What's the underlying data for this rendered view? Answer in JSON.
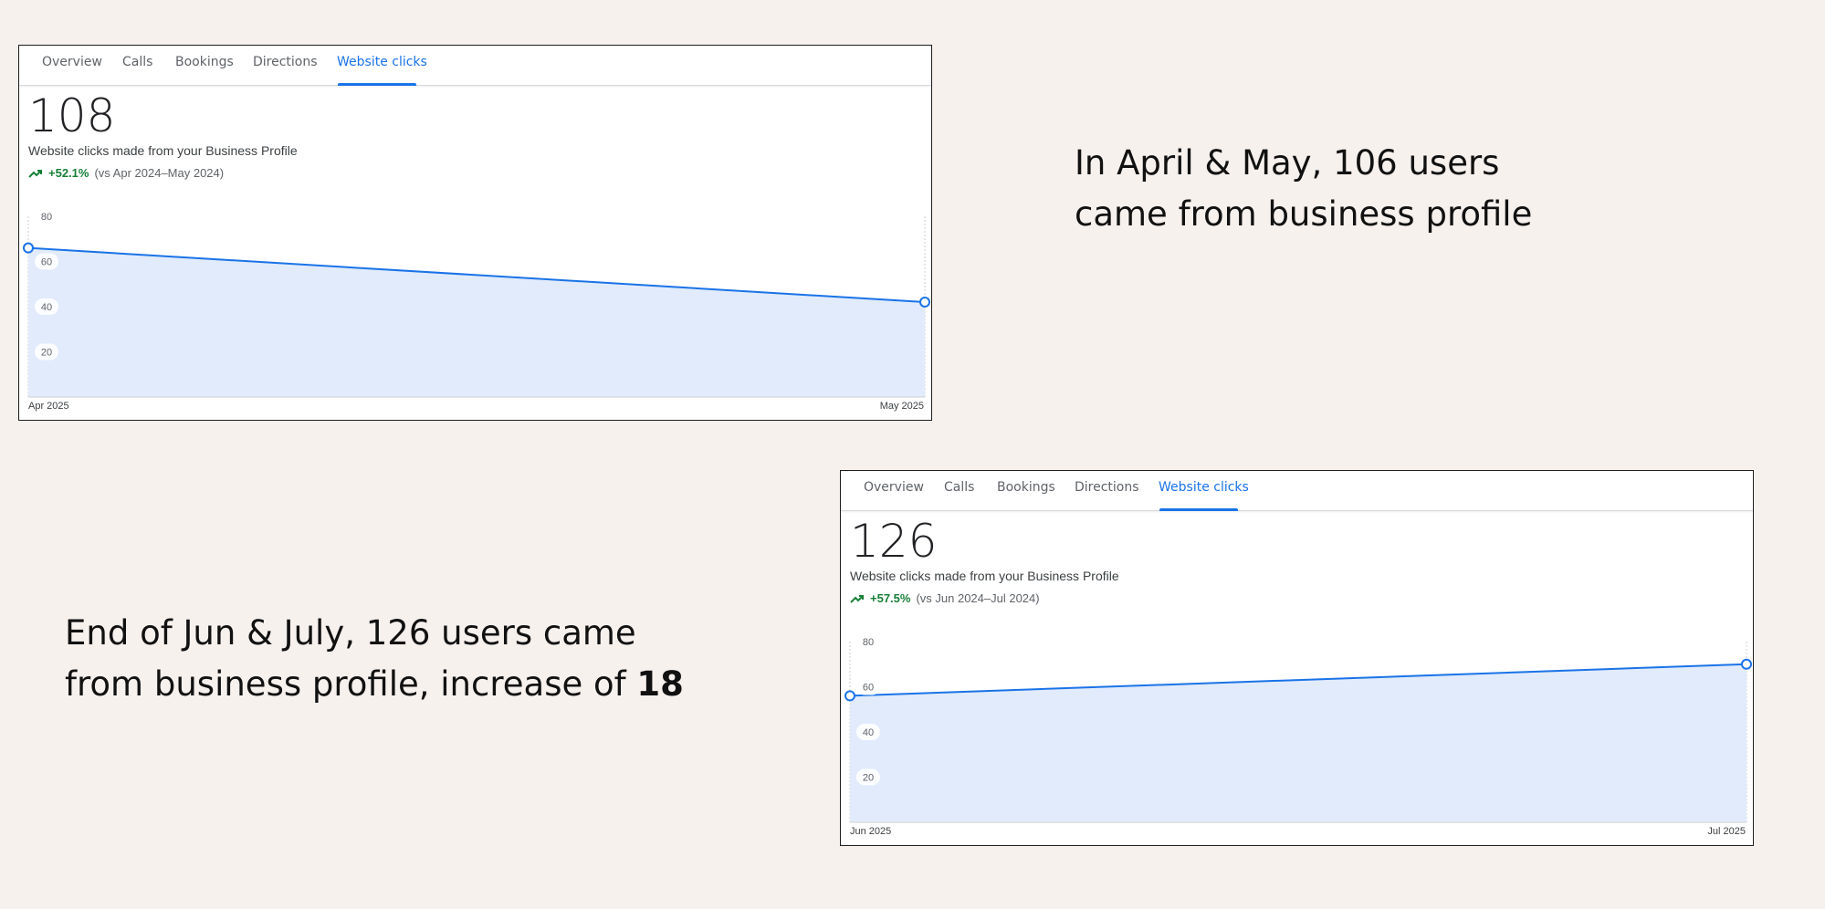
{
  "panels": [
    {
      "tabs": [
        "Overview",
        "Calls",
        "Bookings",
        "Directions",
        "Website clicks"
      ],
      "active_tab": "Website clicks",
      "total": "108",
      "metric_label": "Website clicks made from your Business Profile",
      "trend_pct": "+52.1%",
      "trend_compare": "(vs Apr 2024–May 2024)",
      "x_start_label": "Apr 2025",
      "x_end_label": "May 2025"
    },
    {
      "tabs": [
        "Overview",
        "Calls",
        "Bookings",
        "Directions",
        "Website clicks"
      ],
      "active_tab": "Website clicks",
      "total": "126",
      "metric_label": "Website clicks made from your Business Profile",
      "trend_pct": "+57.5%",
      "trend_compare": "(vs Jun 2024–Jul 2024)",
      "x_start_label": "Jun 2025",
      "x_end_label": "Jul 2025"
    }
  ],
  "chart_data": [
    {
      "type": "area",
      "x": [
        "Apr 2025",
        "May 2025"
      ],
      "series": [
        {
          "values": [
            66,
            42
          ]
        }
      ],
      "yticks": [
        "20",
        "40",
        "60",
        "80"
      ],
      "ylim": [
        0,
        80
      ],
      "grid": false,
      "line_color": "#1a73e8",
      "fill_color": "#e1ebfb"
    },
    {
      "type": "area",
      "x": [
        "Jun 2025",
        "Jul 2025"
      ],
      "series": [
        {
          "values": [
            56,
            70
          ]
        }
      ],
      "yticks": [
        "20",
        "40",
        "60",
        "80"
      ],
      "ylim": [
        0,
        80
      ],
      "grid": false,
      "line_color": "#1a73e8",
      "fill_color": "#e1ebfb"
    }
  ],
  "captions": {
    "top_line1": "In April & May, 106 users",
    "top_line2": "came from business profile",
    "bottom_line1": "End of Jun & July, 126 users came",
    "bottom_line2_prefix": "from business profile, increase of ",
    "bottom_line2_bold": "18"
  },
  "colors": {
    "accent": "#1a73e8",
    "positive": "#188038",
    "background": "#f7f1ee"
  }
}
